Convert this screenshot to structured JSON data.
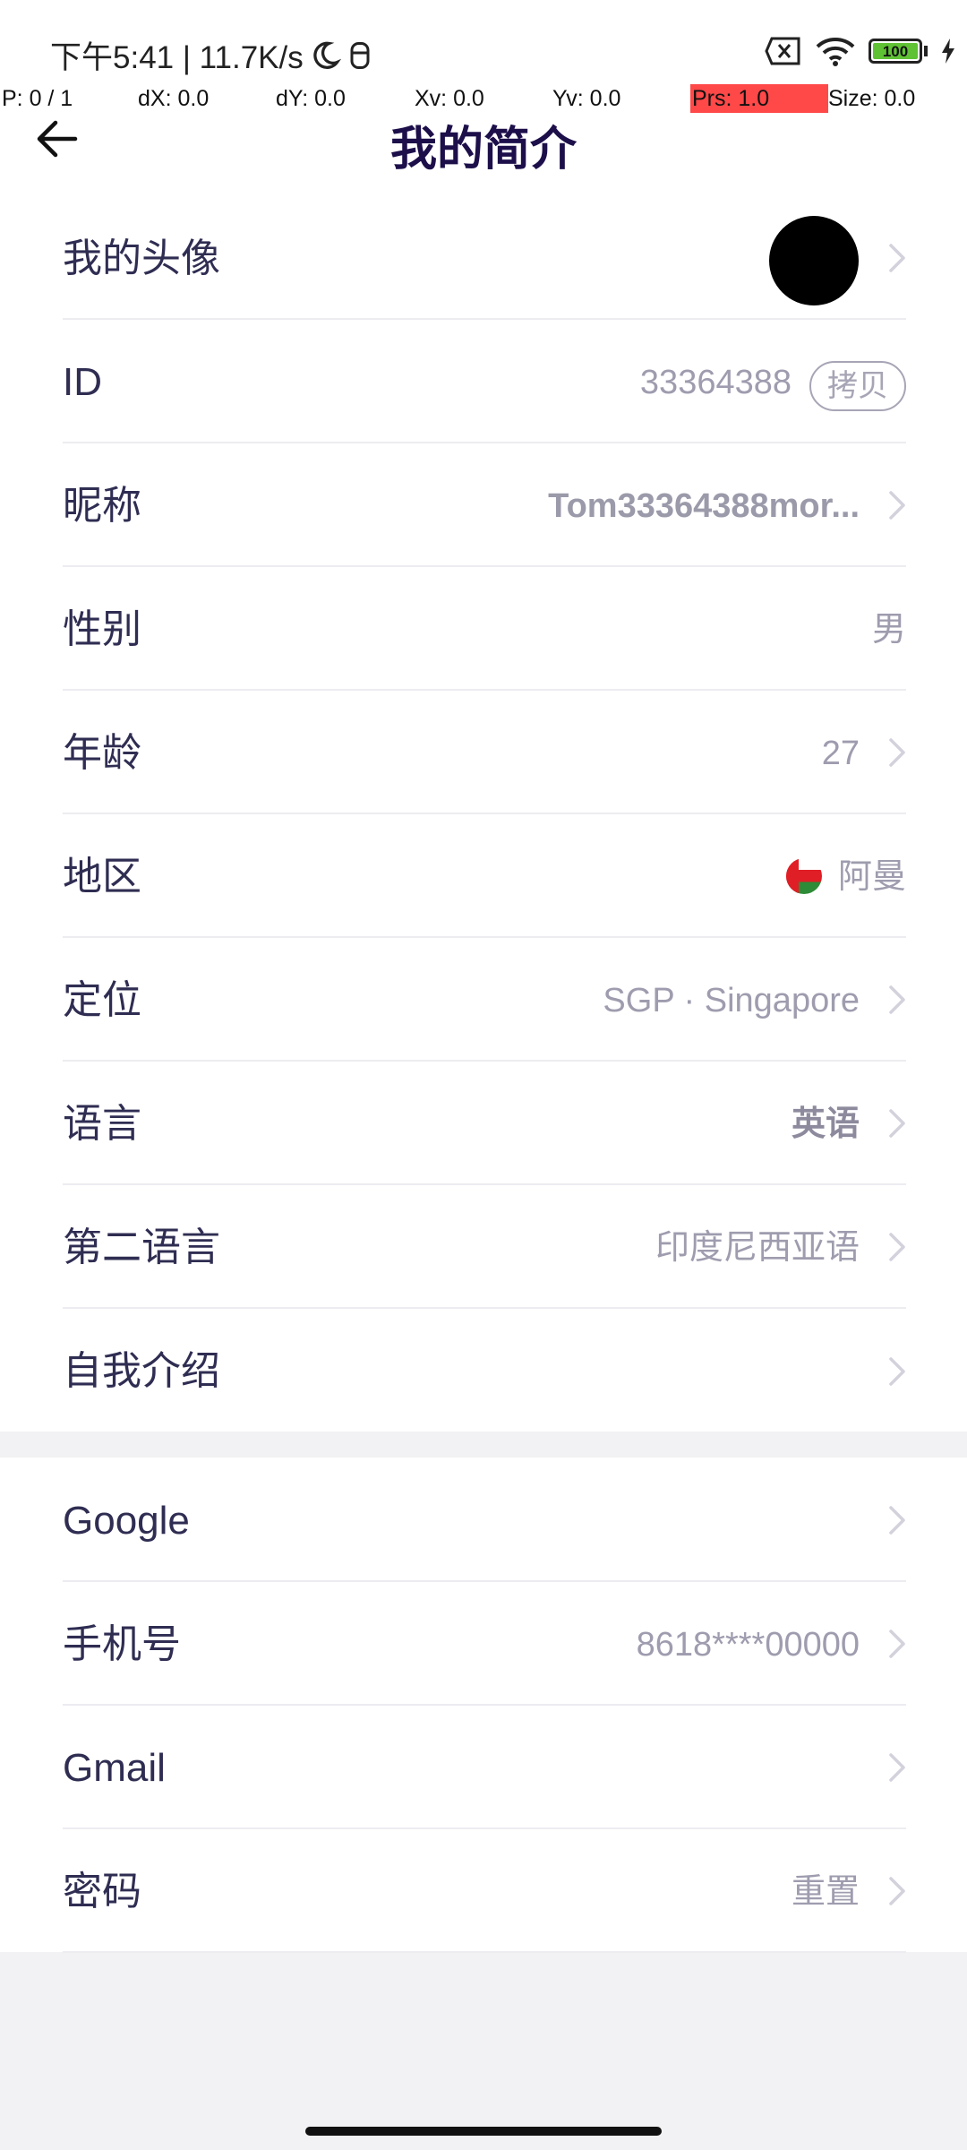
{
  "status_bar": {
    "time_and_speed": "下午5:41 | 11.7K/s",
    "battery": "100"
  },
  "debug_overlay": {
    "p": "P: 0 / 1",
    "dx": "dX: 0.0",
    "dy": "dY: 0.0",
    "xv": "Xv: 0.0",
    "yv": "Yv: 0.0",
    "prs": "Prs: 1.0",
    "size": "Size: 0.0"
  },
  "header": {
    "title": "我的简介"
  },
  "profile": {
    "avatar_label": "我的头像",
    "id_label": "ID",
    "id_value": "33364388",
    "copy_label": "拷贝",
    "nickname_label": "昵称",
    "nickname_value": "Tom33364388mor...",
    "gender_label": "性别",
    "gender_value": "男",
    "age_label": "年龄",
    "age_value": "27",
    "region_label": "地区",
    "region_value": "阿曼",
    "location_label": "定位",
    "location_value": "SGP · Singapore",
    "language_label": "语言",
    "language_value": "英语",
    "second_language_label": "第二语言",
    "second_language_value": "印度尼西亚语",
    "intro_label": "自我介绍"
  },
  "account": {
    "google_label": "Google",
    "phone_label": "手机号",
    "phone_value": "8618****00000",
    "gmail_label": "Gmail",
    "password_label": "密码",
    "password_value": "重置"
  },
  "colors": {
    "accent_text": "#1d0f4a",
    "label_text": "#2f2d52",
    "value_text": "#9e9cae"
  }
}
